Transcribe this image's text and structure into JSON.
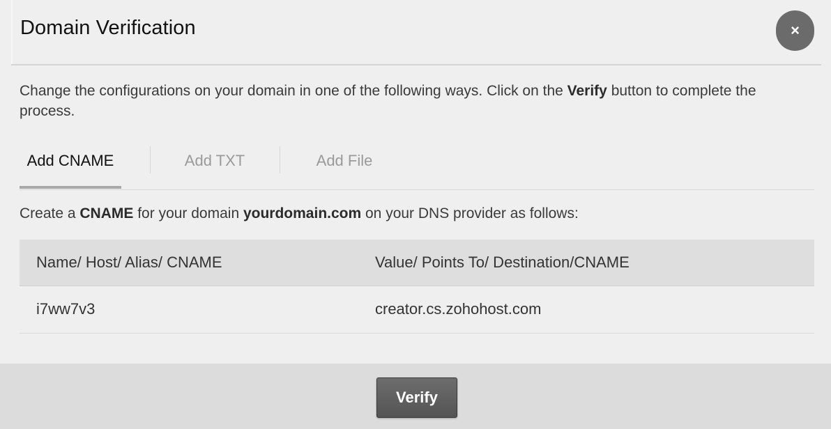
{
  "dialog": {
    "title": "Domain Verification",
    "close_symbol": "×"
  },
  "intro": {
    "text_before": "Change the configurations on your domain in one of the following ways. Click on the ",
    "bold": "Verify",
    "text_after": " button to complete the process."
  },
  "tabs": [
    {
      "label": "Add CNAME",
      "active": true
    },
    {
      "label": "Add TXT",
      "active": false
    },
    {
      "label": "Add File",
      "active": false
    }
  ],
  "instruction": {
    "part1": "Create a ",
    "bold1": "CNAME",
    "part2": " for your domain ",
    "bold2": "yourdomain.com",
    "part3": " on your DNS provider as follows:"
  },
  "table": {
    "headers": [
      "Name/ Host/ Alias/ CNAME",
      "Value/ Points To/ Destination/CNAME"
    ],
    "rows": [
      [
        "i7ww7v3",
        "creator.cs.zohohost.com"
      ]
    ]
  },
  "footer": {
    "verify_label": "Verify"
  },
  "colors": {
    "close_button": "#6b6b6b",
    "verify_button": "#5f5f5f",
    "footer_bg": "#dcdcdc",
    "table_header_bg": "#dedede"
  }
}
